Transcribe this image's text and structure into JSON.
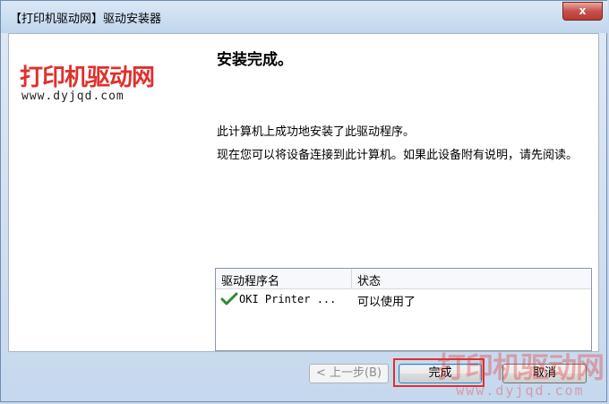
{
  "window": {
    "title": "【打印机驱动网】驱动安装器",
    "close_glyph": "x"
  },
  "branding": {
    "logo_text": "打印机驱动网",
    "logo_url": "www.dyjqd.com"
  },
  "content": {
    "heading": "安装完成。",
    "line1": "此计算机上成功地安装了此驱动程序。",
    "line2": "现在您可以将设备连接到此计算机。如果此设备附有说明，请先阅读。"
  },
  "driver_list": {
    "columns": [
      "驱动程序名",
      "状态"
    ],
    "rows": [
      {
        "name": "OKI Printer ...",
        "status": "可以使用了",
        "icon": "checkmark-icon"
      }
    ]
  },
  "buttons": {
    "back": "< 上一步(B)",
    "finish": "完成",
    "cancel": "取消"
  },
  "watermark": {
    "text": "打印机驱动网",
    "url": "www.dyjqd.com"
  },
  "colors": {
    "brand_red": "#e0302c",
    "check_green": "#2e8b2e",
    "highlight_red": "#e0302c"
  }
}
